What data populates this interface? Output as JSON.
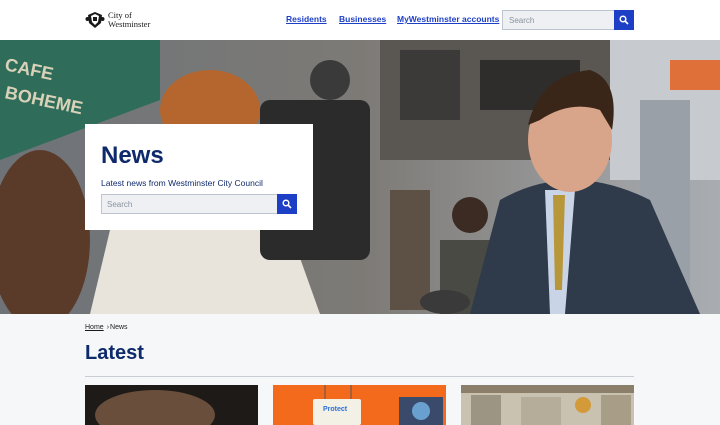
{
  "header": {
    "logo_line1": "City of",
    "logo_line2": "Westminster",
    "nav": [
      "Residents",
      "Businesses",
      "MyWestminster accounts"
    ],
    "search_placeholder": "Search"
  },
  "hero": {
    "title": "News",
    "subtitle": "Latest news from Westminster City Council",
    "search_placeholder": "Search",
    "storefront_text": [
      "CAFE",
      "BOHEME"
    ]
  },
  "breadcrumb": {
    "home": "Home",
    "current": "News"
  },
  "section_title": "Latest",
  "tiles": [
    {
      "image": "dark-photo"
    },
    {
      "image": "orange-photo",
      "sign_text": "Protect"
    },
    {
      "image": "market-photo"
    }
  ],
  "colors": {
    "primary": "#1d3fc6",
    "heading": "#0f2a6b"
  },
  "icons": {
    "search": "search-icon",
    "crest": "crest-icon"
  }
}
